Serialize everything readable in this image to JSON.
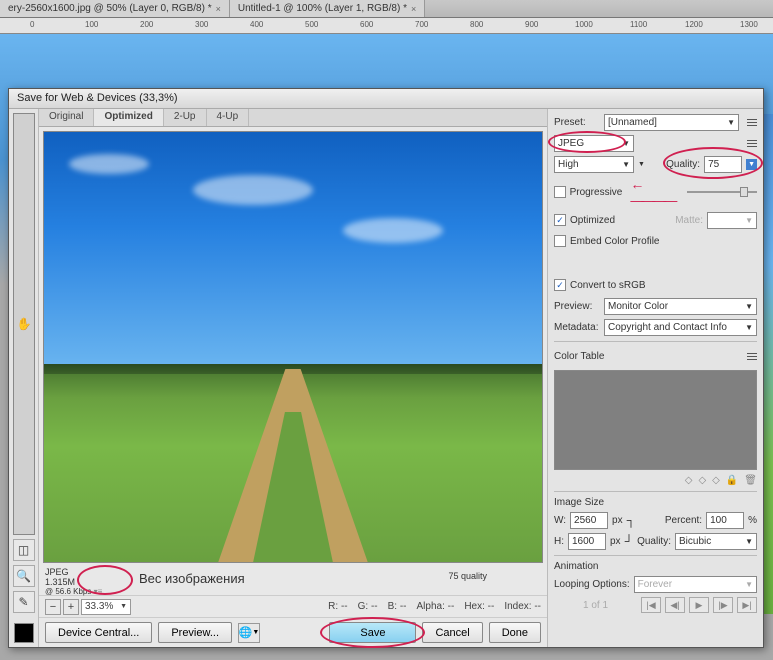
{
  "tabs": [
    {
      "label": "ery-2560x1600.jpg @ 50% (Layer 0, RGB/8) *"
    },
    {
      "label": "Untitled-1 @ 100% (Layer 1, RGB/8) *"
    }
  ],
  "ruler": [
    "0",
    "100",
    "200",
    "300",
    "400",
    "500",
    "600",
    "700",
    "800",
    "900",
    "1000",
    "1100",
    "1200",
    "1300"
  ],
  "dialog": {
    "title": "Save for Web & Devices (33,3%)",
    "viewtabs": [
      "Original",
      "Optimized",
      "2-Up",
      "4-Up"
    ],
    "info": {
      "format": "JPEG",
      "size": "1.315M",
      "speed": "@ 56.6 Kbps",
      "quality": "75 quality"
    },
    "annotation": "Вес изображения",
    "zoom": {
      "value": "33.3%",
      "r": "R: --",
      "g": "G: --",
      "b": "B: --",
      "alpha": "Alpha: --",
      "hex": "Hex: --",
      "index": "Index: --"
    },
    "bottombtns": {
      "device": "Device Central...",
      "preview": "Preview...",
      "save": "Save",
      "cancel": "Cancel",
      "done": "Done"
    }
  },
  "settings": {
    "preset_label": "Preset:",
    "preset_value": "[Unnamed]",
    "format": "JPEG",
    "quality_preset": "High",
    "quality_label": "Quality:",
    "quality_value": "75",
    "progressive": "Progressive",
    "optimized": "Optimized",
    "matte": "Matte:",
    "embed": "Embed Color Profile",
    "convert": "Convert to sRGB",
    "preview_label": "Preview:",
    "preview_value": "Monitor Color",
    "metadata_label": "Metadata:",
    "metadata_value": "Copyright and Contact Info",
    "colortable": "Color Table",
    "imagesize": {
      "title": "Image Size",
      "w_label": "W:",
      "w": "2560",
      "h_label": "H:",
      "h": "1600",
      "px": "px",
      "percent_label": "Percent:",
      "percent": "100",
      "pct": "%",
      "quality_label": "Quality:",
      "quality": "Bicubic"
    },
    "animation": {
      "title": "Animation",
      "loop_label": "Looping Options:",
      "loop": "Forever",
      "count": "1 of 1"
    }
  }
}
